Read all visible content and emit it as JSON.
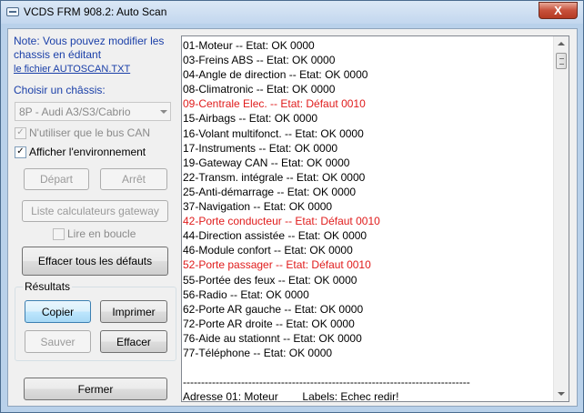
{
  "window": {
    "title": "VCDS FRM 908.2:  Auto Scan",
    "close_glyph": "X"
  },
  "left_panel": {
    "note_text": "Note:  Vous pouvez modifier les chassis en éditant",
    "note_link": "le fichier AUTOSCAN.TXT",
    "chassis_label": "Choisir un châssis:",
    "chassis_value": "8P - Audi A3/S3/Cabrio",
    "can_only_label": "N'utiliser que le bus CAN",
    "can_only_checked": true,
    "show_env_label": "Afficher l'environnement",
    "show_env_checked": true,
    "start_label": "Départ",
    "stop_label": "Arrêt",
    "gateway_list_label": "Liste calculateurs gateway",
    "read_loop_label": "Lire en boucle",
    "read_loop_checked": false,
    "clear_all_label": "Effacer tous les défauts",
    "results_group_label": "Résultats",
    "copy_label": "Copier",
    "print_label": "Imprimer",
    "save_label": "Sauver",
    "clear_label": "Effacer",
    "close_label": "Fermer"
  },
  "results": {
    "lines": [
      {
        "text": "01-Moteur -- Etat: OK 0000",
        "fault": false
      },
      {
        "text": "03-Freins ABS -- Etat: OK 0000",
        "fault": false
      },
      {
        "text": "04-Angle de direction -- Etat: OK 0000",
        "fault": false
      },
      {
        "text": "08-Climatronic -- Etat: OK 0000",
        "fault": false
      },
      {
        "text": "09-Centrale Elec. -- Etat: Défaut 0010",
        "fault": true
      },
      {
        "text": "15-Airbags -- Etat: OK 0000",
        "fault": false
      },
      {
        "text": "16-Volant multifonct. -- Etat: OK 0000",
        "fault": false
      },
      {
        "text": "17-Instruments -- Etat: OK 0000",
        "fault": false
      },
      {
        "text": "19-Gateway CAN -- Etat: OK 0000",
        "fault": false
      },
      {
        "text": "22-Transm. intégrale -- Etat: OK 0000",
        "fault": false
      },
      {
        "text": "25-Anti-démarrage -- Etat: OK 0000",
        "fault": false
      },
      {
        "text": "37-Navigation -- Etat: OK 0000",
        "fault": false
      },
      {
        "text": "42-Porte conducteur -- Etat: Défaut 0010",
        "fault": true
      },
      {
        "text": "44-Direction assistée -- Etat: OK 0000",
        "fault": false
      },
      {
        "text": "46-Module confort -- Etat: OK 0000",
        "fault": false
      },
      {
        "text": "52-Porte passager -- Etat: Défaut 0010",
        "fault": true
      },
      {
        "text": "55-Portée des feux -- Etat: OK 0000",
        "fault": false
      },
      {
        "text": "56-Radio -- Etat: OK 0000",
        "fault": false
      },
      {
        "text": "62-Porte AR gauche -- Etat: OK 0000",
        "fault": false
      },
      {
        "text": "72-Porte AR droite -- Etat: OK 0000",
        "fault": false
      },
      {
        "text": "76-Aide au stationnt -- Etat: OK 0000",
        "fault": false
      },
      {
        "text": "77-Téléphone -- Etat: OK 0000",
        "fault": false
      },
      {
        "text": "",
        "fault": false
      },
      {
        "text": "-------------------------------------------------------------------------------",
        "fault": false
      },
      {
        "text": "Adresse 01: Moteur        Labels: Echec redir!",
        "fault": false
      }
    ]
  },
  "colors": {
    "fault_text": "#e01c1c",
    "note_text": "#1a3fa8"
  }
}
